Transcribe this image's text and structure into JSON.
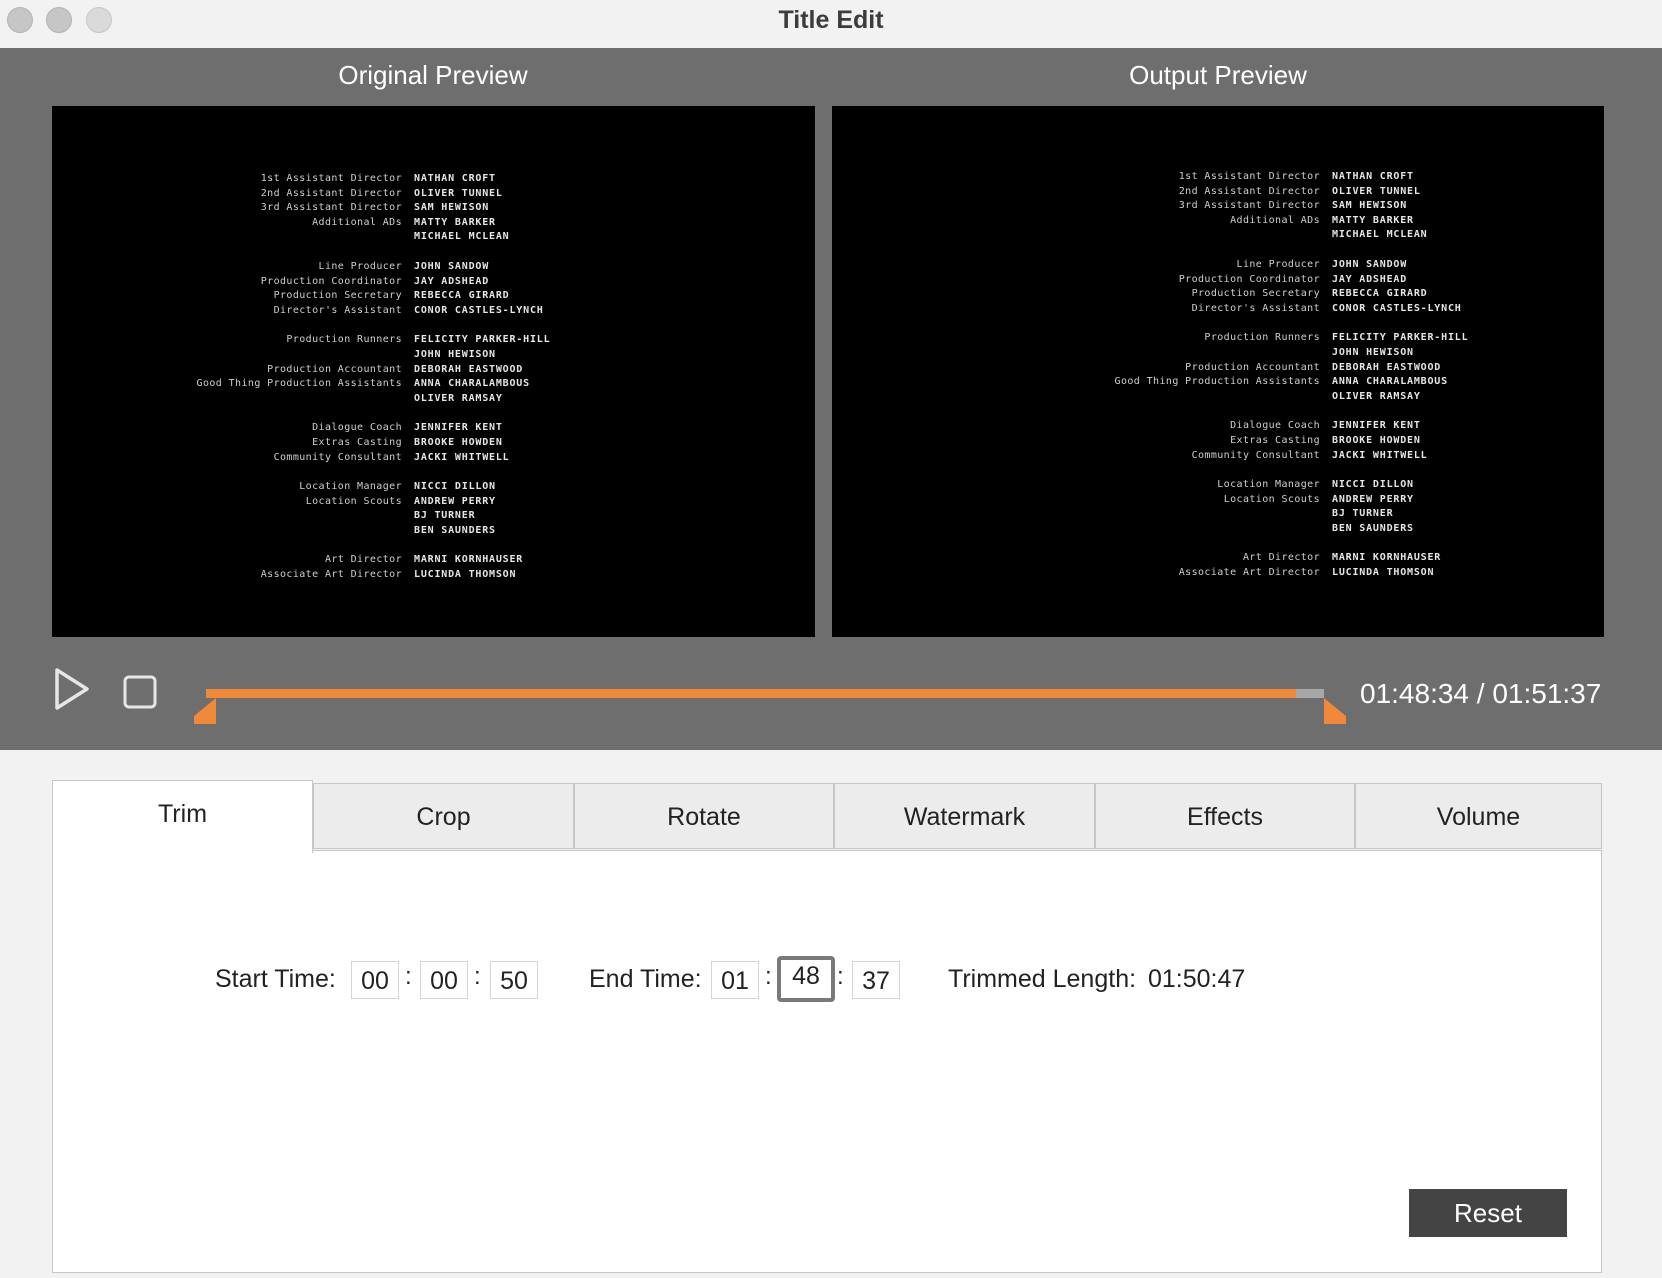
{
  "window": {
    "title": "Title Edit"
  },
  "preview": {
    "original_heading": "Original Preview",
    "output_heading": "Output  Preview",
    "credits": [
      [
        [
          "1st Assistant Director",
          "NATHAN CROFT"
        ],
        [
          "2nd Assistant Director",
          "OLIVER TUNNEL"
        ],
        [
          "3rd Assistant Director",
          "SAM HEWISON"
        ],
        [
          "Additional ADs",
          "MATTY BARKER"
        ],
        [
          "",
          "MICHAEL MCLEAN"
        ]
      ],
      [
        [
          "Line Producer",
          "JOHN SANDOW"
        ],
        [
          "Production Coordinator",
          "JAY ADSHEAD"
        ],
        [
          "Production Secretary",
          "REBECCA GIRARD"
        ],
        [
          "Director's Assistant",
          "CONOR CASTLES-LYNCH"
        ]
      ],
      [
        [
          "Production Runners",
          "FELICITY PARKER-HILL"
        ],
        [
          "",
          "JOHN HEWISON"
        ],
        [
          "Production Accountant",
          "DEBORAH EASTWOOD"
        ],
        [
          "Good Thing Production Assistants",
          "ANNA CHARALAMBOUS"
        ],
        [
          "",
          "OLIVER RAMSAY"
        ]
      ],
      [
        [
          "Dialogue Coach",
          "JENNIFER KENT"
        ],
        [
          "Extras Casting",
          "BROOKE HOWDEN"
        ],
        [
          "Community Consultant",
          "JACKI WHITWELL"
        ]
      ],
      [
        [
          "Location Manager",
          "NICCI DILLON"
        ],
        [
          "Location Scouts",
          "ANDREW PERRY"
        ],
        [
          "",
          "BJ TURNER"
        ],
        [
          "",
          "BEN SAUNDERS"
        ]
      ],
      [
        [
          "Art Director",
          "MARNI KORNHAUSER"
        ],
        [
          "Associate Art Director",
          "LUCINDA THOMSON"
        ]
      ]
    ]
  },
  "transport": {
    "play_icon": "play-icon",
    "stop_icon": "stop-icon",
    "progress_fraction": 0.975,
    "timecode": "01:48:34 / 01:51:37",
    "accent_color": "#f0893a"
  },
  "tabs": [
    {
      "label": "Trim",
      "active": true
    },
    {
      "label": "Crop",
      "active": false
    },
    {
      "label": "Rotate",
      "active": false
    },
    {
      "label": "Watermark",
      "active": false
    },
    {
      "label": "Effects",
      "active": false
    },
    {
      "label": "Volume",
      "active": false
    }
  ],
  "trim": {
    "start_label": "Start Time:",
    "start": [
      "00",
      "00",
      "50"
    ],
    "end_label": "End Time:",
    "end": [
      "01",
      "48",
      "37"
    ],
    "separator": ":",
    "length_label": "Trimmed Length:",
    "length_value": "01:50:47"
  },
  "reset_label": "Reset"
}
